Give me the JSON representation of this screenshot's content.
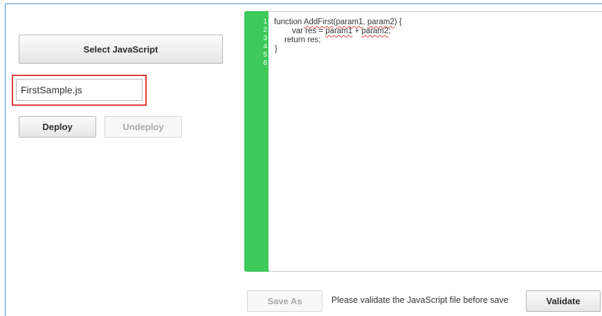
{
  "left_panel": {
    "select_button_label": "Select JavaScript",
    "file_name_value": "FirstSample.js",
    "deploy_label": "Deploy",
    "undeploy_label": "Undeploy"
  },
  "editor": {
    "line_numbers": [
      "1",
      "2",
      "3",
      "4",
      "5",
      "6"
    ],
    "code": {
      "line1": {
        "pre": "function ",
        "fn": "AddFirst",
        "open": "(",
        "p1": "param1",
        "comma": ", ",
        "p2": "param2",
        "close": ") {"
      },
      "line2": {
        "pre": "var res = ",
        "p1": "param1",
        "mid": " + ",
        "p2": "param2",
        "end": ";"
      },
      "line3": "return res;",
      "line4": "}"
    },
    "gutter_color": "#3ec95a"
  },
  "footer": {
    "save_as_label": "Save As",
    "status_text": "Please validate the JavaScript file before save",
    "validate_label": "Validate"
  },
  "colors": {
    "highlight_border": "#e63b3b",
    "frame_border": "#4b8fd0"
  }
}
